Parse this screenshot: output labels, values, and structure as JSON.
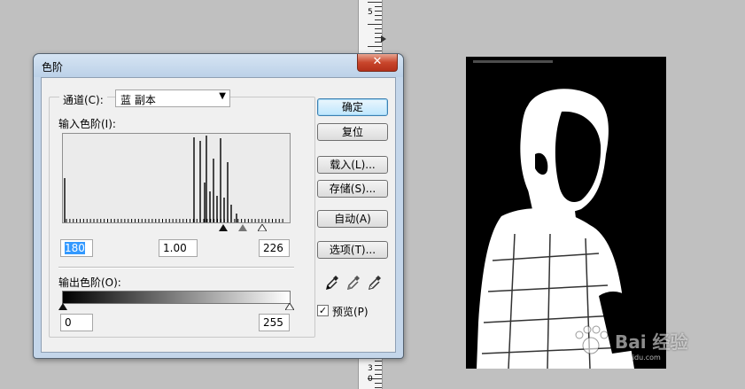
{
  "dialog": {
    "title": "色阶",
    "close_label": "✕"
  },
  "channel": {
    "label": "通道(C):",
    "value": "蓝 副本"
  },
  "input_levels": {
    "label": "输入色阶(I):",
    "black": "180",
    "gamma": "1.00",
    "white": "226"
  },
  "output_levels": {
    "label": "输出色阶(O):",
    "black": "0",
    "white": "255"
  },
  "buttons": {
    "ok": "确定",
    "reset": "复位",
    "load": "载入(L)...",
    "save": "存储(S)...",
    "auto": "自动(A)",
    "options": "选项(T)..."
  },
  "preview": {
    "label": "预览(P)",
    "checked": true,
    "check_glyph": "✓"
  },
  "ruler": {
    "numbers": [
      "5",
      "3",
      "0"
    ]
  },
  "watermark": {
    "brand": "Bai 经验",
    "url": "jingyan.baidu.com"
  },
  "histogram": {
    "baseline_bins": 64,
    "spikes": [
      {
        "level": 2,
        "height": 0.5
      },
      {
        "level": 148,
        "height": 0.96
      },
      {
        "level": 155,
        "height": 0.92
      },
      {
        "level": 162,
        "height": 0.98
      },
      {
        "level": 170,
        "height": 0.72
      },
      {
        "level": 178,
        "height": 0.95
      },
      {
        "level": 186,
        "height": 0.68
      },
      {
        "level": 160,
        "height": 0.45
      },
      {
        "level": 166,
        "height": 0.35
      },
      {
        "level": 174,
        "height": 0.3
      },
      {
        "level": 182,
        "height": 0.28
      },
      {
        "level": 190,
        "height": 0.2
      },
      {
        "level": 196,
        "height": 0.1
      }
    ]
  }
}
